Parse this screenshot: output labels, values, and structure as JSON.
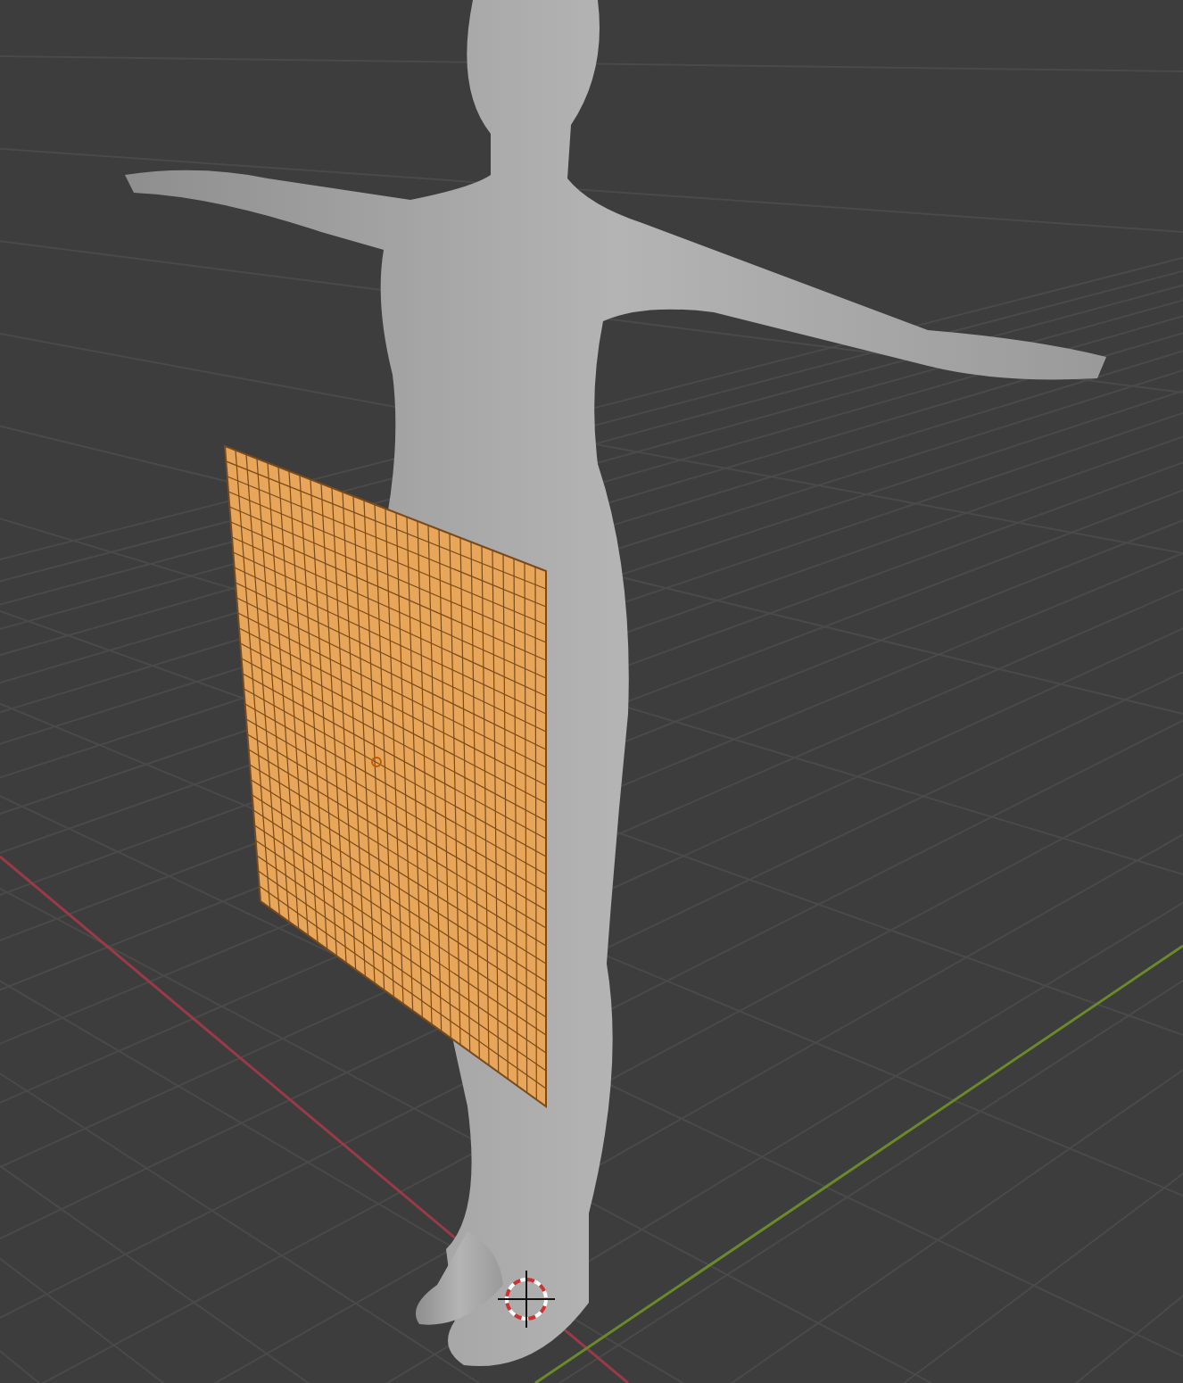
{
  "viewport": {
    "objects": [
      {
        "kind": "figure",
        "selected": false
      },
      {
        "kind": "plane",
        "selected": true
      }
    ]
  }
}
